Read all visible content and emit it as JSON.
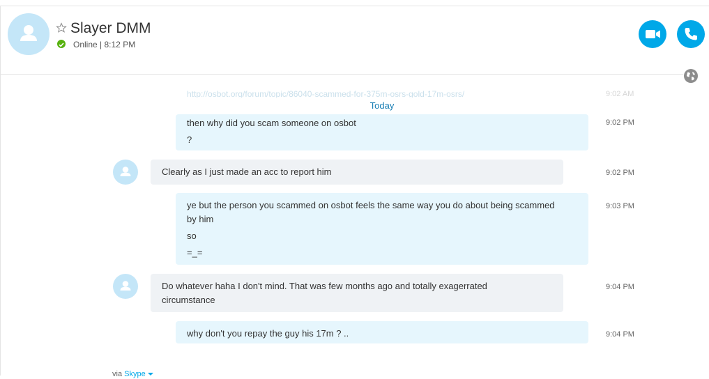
{
  "header": {
    "contact_name": "Slayer DMM",
    "status": "Online",
    "status_separator": "|",
    "local_time": "8:12 PM",
    "avatar_icon": "person-icon",
    "favorite_icon": "star-outline-icon",
    "status_icon": "online-check-icon",
    "video_call_icon": "video-camera-icon",
    "audio_call_icon": "phone-icon",
    "accent_color": "#00a8e8",
    "online_color": "#57b20f"
  },
  "conversation": {
    "faded_link": "http://osbot.org/forum/topic/86040-scammed-for-375m-osrs-gold-17m-osrs/",
    "faded_time": "9:02 AM",
    "date_divider": "Today",
    "translator_icon": "globe-icon",
    "messages": [
      {
        "direction": "out",
        "lines": [
          "then why did you scam someone on osbot",
          "?"
        ],
        "time": "9:02 PM"
      },
      {
        "direction": "in",
        "lines": [
          "Clearly as I just made an acc to report him"
        ],
        "time": "9:02 PM"
      },
      {
        "direction": "out",
        "lines": [
          "ye but the person you scammed on osbot feels the same way you do about being scammed\nby him",
          "so",
          "=_="
        ],
        "time": "9:03 PM"
      },
      {
        "direction": "in",
        "lines": [
          "Do whatever haha I don't mind. That was few months ago and totally exagerrated\ncircumstance"
        ],
        "time": "9:04 PM"
      },
      {
        "direction": "out",
        "lines": [
          "why don't you repay the guy his 17m ? .."
        ],
        "time": "9:04 PM"
      }
    ]
  },
  "footer": {
    "via_label": "via",
    "service": "Skype"
  }
}
